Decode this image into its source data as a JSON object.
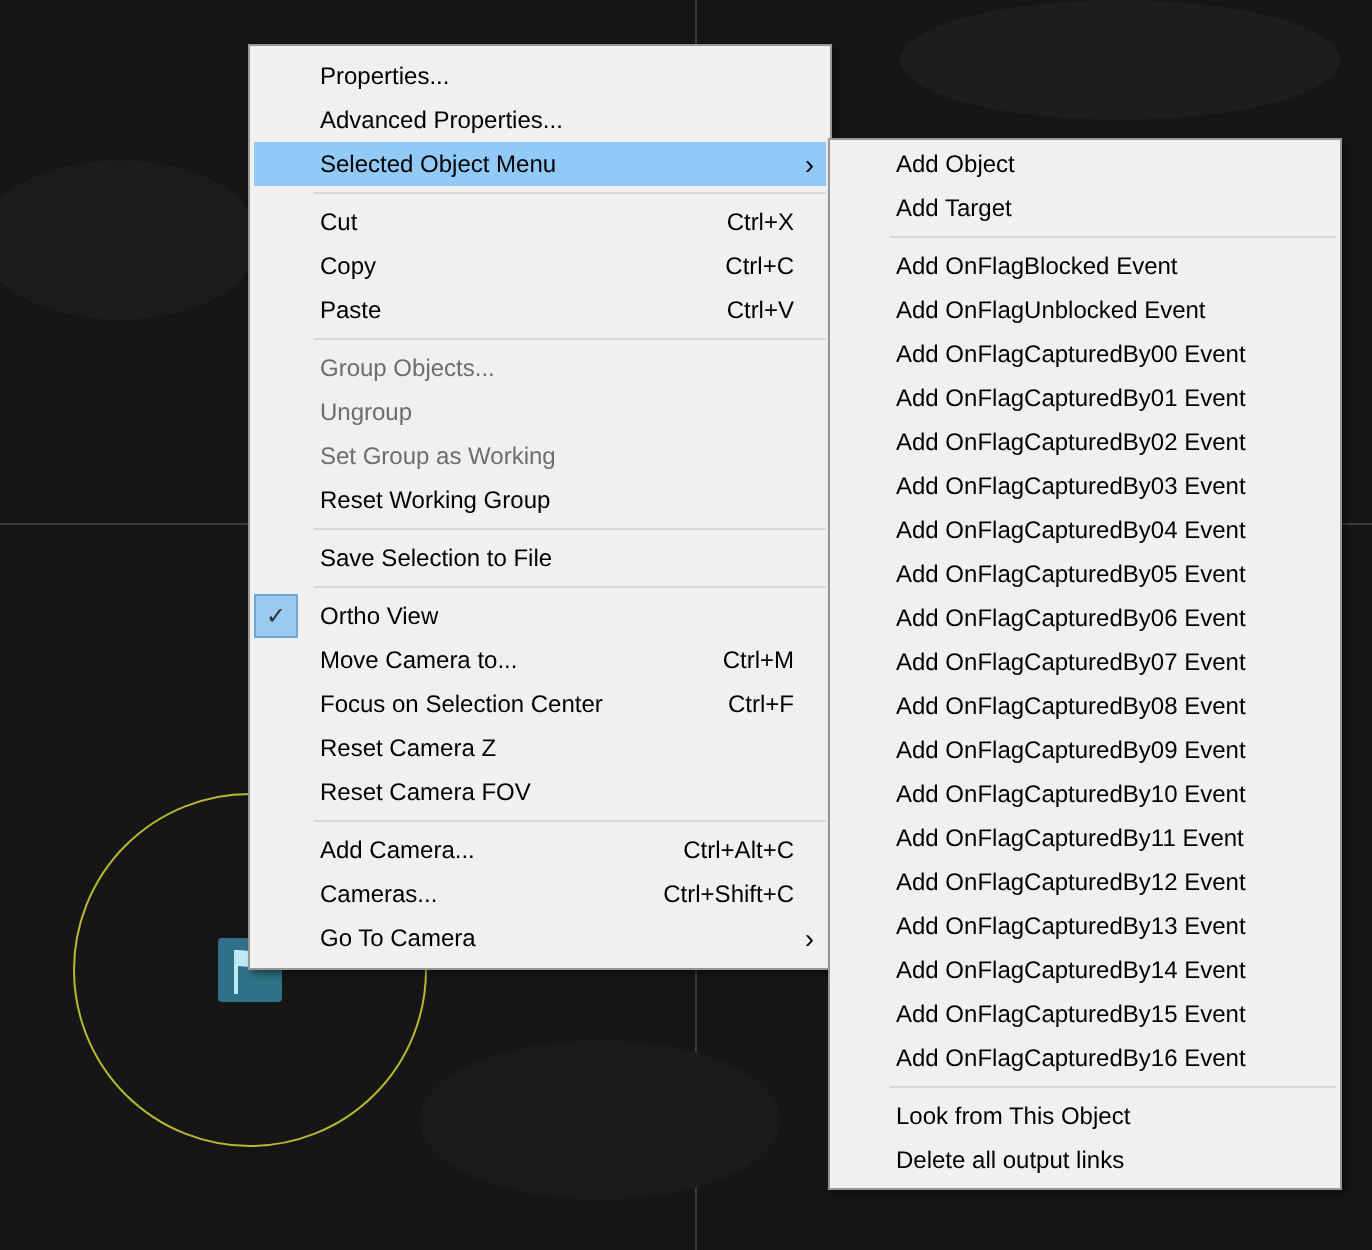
{
  "context_menu": {
    "items": [
      {
        "kind": "item",
        "label": "Properties...",
        "disabled": false,
        "checked": false,
        "selected": false
      },
      {
        "kind": "item",
        "label": "Advanced Properties...",
        "disabled": false,
        "checked": false,
        "selected": false
      },
      {
        "kind": "item",
        "label": "Selected Object Menu",
        "arrow": "›",
        "disabled": false,
        "checked": false,
        "selected": true
      },
      {
        "kind": "separator"
      },
      {
        "kind": "item",
        "label": "Cut",
        "shortcut": "Ctrl+X",
        "disabled": false,
        "checked": false,
        "selected": false
      },
      {
        "kind": "item",
        "label": "Copy",
        "shortcut": "Ctrl+C",
        "disabled": false,
        "checked": false,
        "selected": false
      },
      {
        "kind": "item",
        "label": "Paste",
        "shortcut": "Ctrl+V",
        "disabled": false,
        "checked": false,
        "selected": false
      },
      {
        "kind": "separator"
      },
      {
        "kind": "item",
        "label": "Group Objects...",
        "disabled": true,
        "checked": false,
        "selected": false
      },
      {
        "kind": "item",
        "label": "Ungroup",
        "disabled": true,
        "checked": false,
        "selected": false
      },
      {
        "kind": "item",
        "label": "Set Group as Working",
        "disabled": true,
        "checked": false,
        "selected": false
      },
      {
        "kind": "item",
        "label": "Reset Working Group",
        "disabled": false,
        "checked": false,
        "selected": false
      },
      {
        "kind": "separator"
      },
      {
        "kind": "item",
        "label": "Save Selection to File",
        "disabled": false,
        "checked": false,
        "selected": false
      },
      {
        "kind": "separator"
      },
      {
        "kind": "item",
        "label": "Ortho View",
        "check_mark": "✓",
        "disabled": false,
        "checked": true,
        "selected": false
      },
      {
        "kind": "item",
        "label": "Move Camera to...",
        "shortcut": "Ctrl+M",
        "disabled": false,
        "checked": false,
        "selected": false
      },
      {
        "kind": "item",
        "label": "Focus on Selection Center",
        "shortcut": "Ctrl+F",
        "disabled": false,
        "checked": false,
        "selected": false
      },
      {
        "kind": "item",
        "label": "Reset Camera Z",
        "disabled": false,
        "checked": false,
        "selected": false
      },
      {
        "kind": "item",
        "label": "Reset Camera FOV",
        "disabled": false,
        "checked": false,
        "selected": false
      },
      {
        "kind": "separator"
      },
      {
        "kind": "item",
        "label": "Add Camera...",
        "shortcut": "Ctrl+Alt+C",
        "disabled": false,
        "checked": false,
        "selected": false
      },
      {
        "kind": "item",
        "label": "Cameras...",
        "shortcut": "Ctrl+Shift+C",
        "disabled": false,
        "checked": false,
        "selected": false
      },
      {
        "kind": "item",
        "label": "Go To Camera",
        "arrow": "›",
        "disabled": false,
        "checked": false,
        "selected": false
      }
    ]
  },
  "submenu": {
    "items": [
      {
        "kind": "item",
        "label": "Add Object"
      },
      {
        "kind": "item",
        "label": "Add Target"
      },
      {
        "kind": "separator"
      },
      {
        "kind": "item",
        "label": "Add OnFlagBlocked Event"
      },
      {
        "kind": "item",
        "label": "Add OnFlagUnblocked Event"
      },
      {
        "kind": "item",
        "label": "Add OnFlagCapturedBy00 Event"
      },
      {
        "kind": "item",
        "label": "Add OnFlagCapturedBy01 Event"
      },
      {
        "kind": "item",
        "label": "Add OnFlagCapturedBy02 Event"
      },
      {
        "kind": "item",
        "label": "Add OnFlagCapturedBy03 Event"
      },
      {
        "kind": "item",
        "label": "Add OnFlagCapturedBy04 Event"
      },
      {
        "kind": "item",
        "label": "Add OnFlagCapturedBy05 Event"
      },
      {
        "kind": "item",
        "label": "Add OnFlagCapturedBy06 Event"
      },
      {
        "kind": "item",
        "label": "Add OnFlagCapturedBy07 Event"
      },
      {
        "kind": "item",
        "label": "Add OnFlagCapturedBy08 Event"
      },
      {
        "kind": "item",
        "label": "Add OnFlagCapturedBy09 Event"
      },
      {
        "kind": "item",
        "label": "Add OnFlagCapturedBy10 Event"
      },
      {
        "kind": "item",
        "label": "Add OnFlagCapturedBy11 Event"
      },
      {
        "kind": "item",
        "label": "Add OnFlagCapturedBy12 Event"
      },
      {
        "kind": "item",
        "label": "Add OnFlagCapturedBy13 Event"
      },
      {
        "kind": "item",
        "label": "Add OnFlagCapturedBy14 Event"
      },
      {
        "kind": "item",
        "label": "Add OnFlagCapturedBy15 Event"
      },
      {
        "kind": "item",
        "label": "Add OnFlagCapturedBy16 Event"
      },
      {
        "kind": "separator"
      },
      {
        "kind": "item",
        "label": "Look from This Object"
      },
      {
        "kind": "item",
        "label": "Delete all output links"
      }
    ]
  }
}
